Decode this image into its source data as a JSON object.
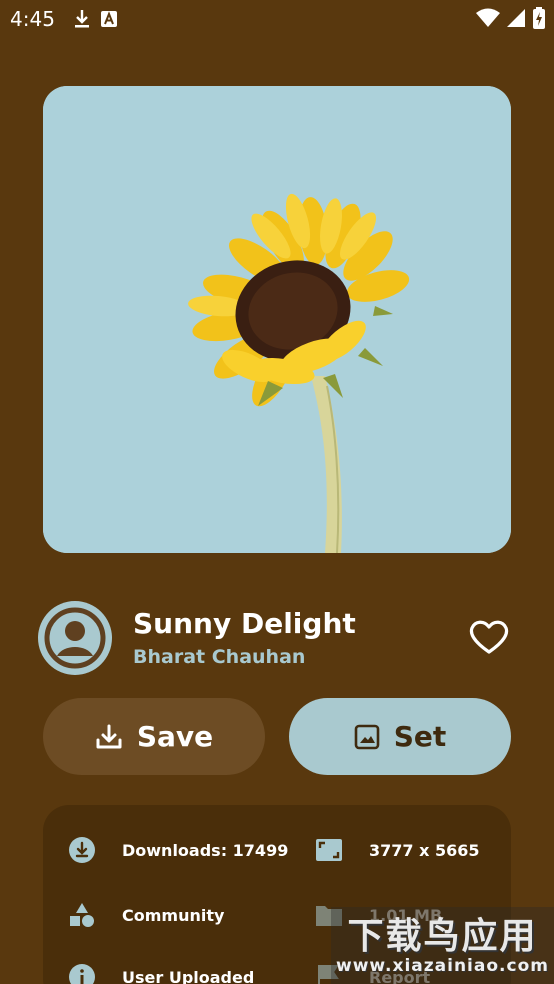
{
  "status_bar": {
    "time": "4:45",
    "left_icons": [
      "download-icon",
      "text-a-icon"
    ],
    "right_icons": [
      "wifi-icon",
      "signal-icon",
      "battery-icon"
    ]
  },
  "wallpaper": {
    "title": "Sunny Delight",
    "author": "Bharat Chauhan",
    "background_color": "#acd1da"
  },
  "actions": {
    "save_label": "Save",
    "set_label": "Set"
  },
  "details": {
    "downloads": "Downloads: 17499",
    "resolution": "3777 x 5665",
    "category": "Community",
    "size": "1.01 MB",
    "source": "User Uploaded",
    "report": "Report"
  },
  "watermark": {
    "chinese": "下载鸟应用",
    "url": "www.xiazainiao.com"
  },
  "colors": {
    "background": "#59380e",
    "card": "#4a2e0a",
    "accent": "#a9c9cf",
    "save_button": "#6d4c24"
  }
}
